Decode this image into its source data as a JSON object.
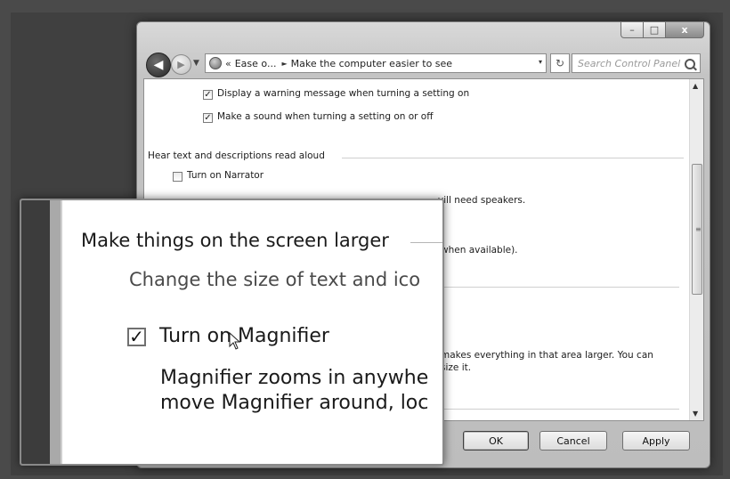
{
  "window": {
    "caption_buttons": {
      "minimize": "–",
      "maximize": "□",
      "close": "x"
    }
  },
  "navigation": {
    "back_icon": "back-arrow-icon",
    "forward_icon": "forward-arrow-icon",
    "recent_pages_icon": "dropdown-arrow-icon"
  },
  "address_bar": {
    "double_chevron": "«",
    "segment_1": "Ease o...",
    "separator": "►",
    "segment_2": "Make the computer easier to see",
    "dropdown": "▾",
    "refresh_glyph": "↻"
  },
  "search": {
    "placeholder": "Search Control Panel"
  },
  "content": {
    "warning_message_checkbox": {
      "label": "Display a warning message when turning a setting on",
      "checked": true
    },
    "sound_checkbox": {
      "label": "Make a sound when turning a setting on or off",
      "checked": true
    },
    "hear_text_heading": "Hear text and descriptions read aloud",
    "narrator_checkbox": {
      "label": "Turn on Narrator",
      "checked": false
    },
    "narrator_desc_fragment": "vill need speakers.",
    "audio_desc_fragment": "when available).",
    "magnifier_desc_fragment_1": "makes everything in that area larger. You can",
    "magnifier_desc_fragment_2": "size it."
  },
  "buttons": {
    "ok": "OK",
    "cancel": "Cancel",
    "apply": "Apply"
  },
  "magnifier_lens": {
    "heading": "Make things on the screen larger",
    "subheading": "Change the size of text and ico",
    "checkbox_label": "Turn on Magnifier",
    "checkbox_checked": true,
    "description_line_1": "Magnifier zooms in anywhe",
    "description_line_2": "move Magnifier around, loc",
    "check_glyph": "✓",
    "cursor_icon": "mouse-pointer-icon"
  }
}
